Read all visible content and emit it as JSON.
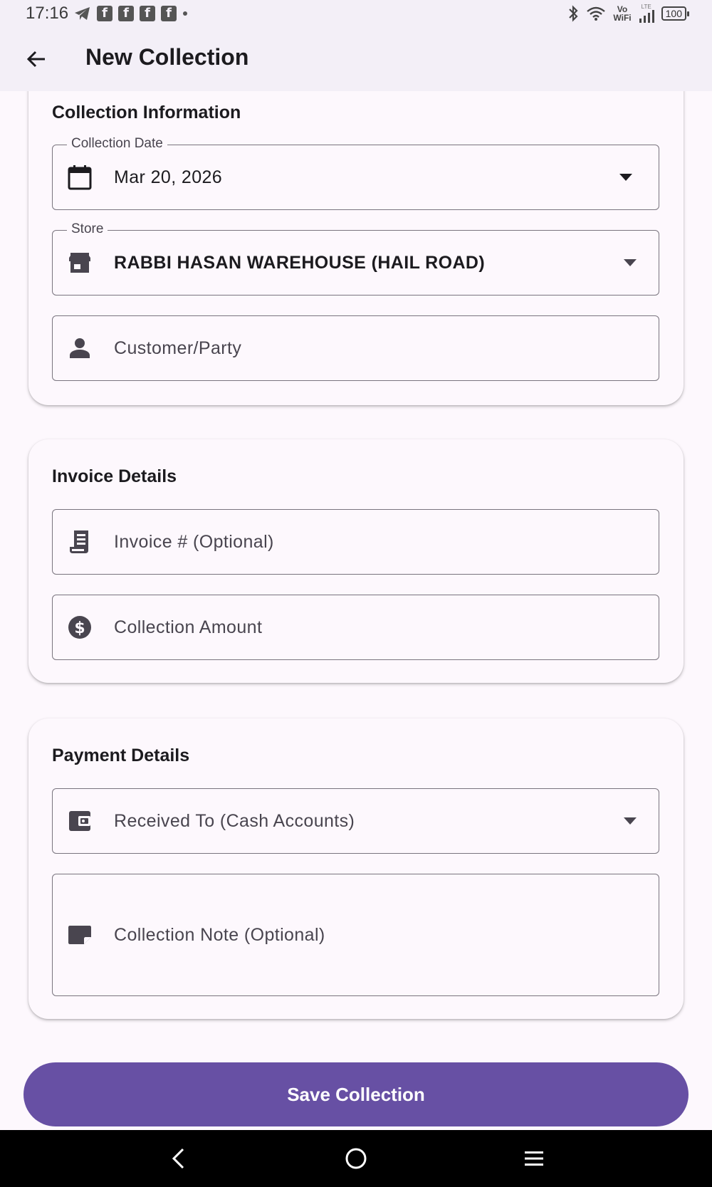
{
  "status_bar": {
    "time": "17:16",
    "fb_letter": "f",
    "vowifi_top": "Vo",
    "vowifi_bottom": "WiFi",
    "lte": "LTE",
    "battery": "100"
  },
  "app_bar": {
    "title": "New Collection",
    "back_icon": "arrow-back-icon"
  },
  "collection_info": {
    "title": "Collection Information",
    "date_field": {
      "label": "Collection Date",
      "value": "Mar 20, 2026",
      "icon": "calendar-icon"
    },
    "store_field": {
      "label": "Store",
      "value": "RABBI HASAN WAREHOUSE (HAIL ROAD)",
      "icon": "store-icon"
    },
    "customer_field": {
      "placeholder": "Customer/Party",
      "icon": "person-icon"
    }
  },
  "invoice_details": {
    "title": "Invoice Details",
    "invoice_field": {
      "placeholder": "Invoice # (Optional)",
      "icon": "receipt-icon"
    },
    "amount_field": {
      "placeholder": "Collection Amount",
      "icon": "dollar-icon"
    }
  },
  "payment_details": {
    "title": "Payment Details",
    "received_field": {
      "placeholder": "Received To (Cash Accounts)",
      "icon": "wallet-icon"
    },
    "note_field": {
      "placeholder": "Collection Note (Optional)",
      "icon": "note-icon"
    }
  },
  "save_button": {
    "label": "Save Collection"
  },
  "colors": {
    "primary": "#6750a4",
    "background": "#fdf8fd",
    "app_bar": "#f3eff7",
    "outline": "#79747e"
  }
}
